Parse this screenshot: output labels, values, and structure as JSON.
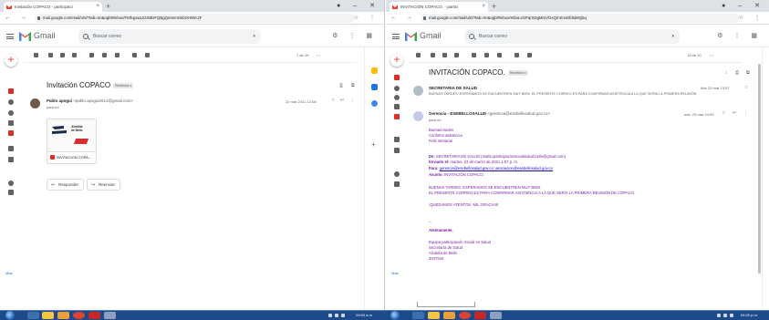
{
  "left_window": {
    "tab_title": "Invitación COPACO - participaci",
    "url": "mail.google.com/mail/u/0/?tab=rm&ogbl#inbox/FMfcgxwLtGXBDFQBgQmmmGkbGHtWcJF",
    "gmail_wordmark": "Gmail",
    "search_placeholder": "Buscar correo",
    "pagination": "1 de 19",
    "subject": "Invitación COPACO",
    "label": "Recibidos x",
    "sender_name": "Pablo apsgui",
    "sender_email": "<pablo.apsgui2014@gmail.com>",
    "to": "para mí",
    "date": "22 mar 2021 13:08",
    "attachment_brand_line1": "Alcaldía",
    "attachment_brand_line2": "de Bello",
    "attachment_name": "INVITACION COPA...",
    "reply_label": "Responder",
    "forward_label": "Reenviar",
    "nav_more": "Más"
  },
  "right_window": {
    "tab_title": "INVITACIÓN COPACO. - partici",
    "url": "mail.google.com/mail/u/0/?tab=rm&ogbl#inbox/KtbxLsGPqrSDgMmVfzxQrnSnxDfdsb8Qbq",
    "gmail_wordmark": "Gmail",
    "search_placeholder": "Buscar correo",
    "pagination": "13 de 19",
    "subject": "INVITACIÓN COPACO.",
    "label": "Recibidos x",
    "msg1_sender": "SECRETARIA DE SALUD",
    "msg1_snippet": "BUENAS TARDES. ESPERAMOS SE ENCUENTREN MUY BIEN. EL PRESENTE CORREO ES PARA CONFIRMAR ASISTENCIA A LA QUE SERÍA LA PRIMERA REUNIÓN.",
    "msg1_date": "Mar 23 mar 13:57",
    "msg2_sender_name": "Gerencia - ESEBELLOSALUD",
    "msg2_sender_email": "<gerencia@esebellosalud.gov.co>",
    "msg2_to": "para mí",
    "msg2_date": "mar. 23 mar 14:00",
    "greeting_lines": [
      "Buenas tardes",
      "Confirmo asistencia",
      "Feliz semana!"
    ],
    "fwd_de_label": "De:",
    "fwd_de_value": "SECRETARIA DE SALUD [mailto:participacionsocialsalud.bello@gmail.com]",
    "fwd_enviado_label": "Enviado el:",
    "fwd_enviado_value": "martes, 23 de marzo de 2021 1:57 p. m.",
    "fwd_para_label": "Para:",
    "fwd_para_value": "gerencia@esebellosalud.gov.co; asociacion@esebellosalud.gov.co",
    "fwd_asunto_label": "Asunto:",
    "fwd_asunto_value": "INVITACIÓN COPACO.",
    "body_line1": "BUENAS TARDES. ESPERAMOS SE ENCUENTREN MUY BIEN.",
    "body_line2": "EL PRESENTE CORREO ES PARA CONFIRMAR ASISTENCIA A LA QUE SERÍA LA PRIMERA REUNIÓN DE COPACO",
    "body_line3": "¡QUEDAMOS ATENTOS. MIL GRACIAS!",
    "dashes": "--",
    "signoff": "Atentamente,",
    "sig_lines": [
      "Equipo participación Social en Salud",
      "Secretaría de Salud",
      "Alcaldía de Bello",
      "3047844"
    ],
    "nav_more": "Más"
  },
  "taskbar": {
    "left_time": "09:53 a.m.",
    "right_time": "04:00 p.m."
  },
  "colors": {
    "gmail_red": "#ea4335",
    "purple_text": "#7b1fa2",
    "taskbar": "#1c4a8a"
  }
}
